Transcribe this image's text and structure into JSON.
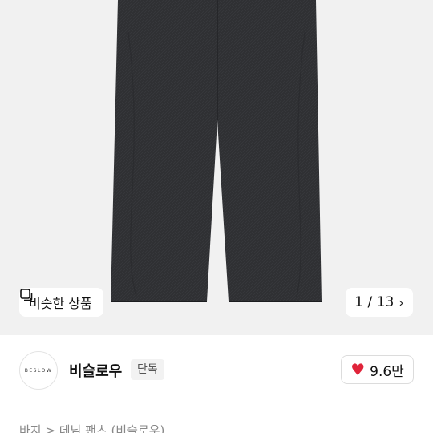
{
  "product_image": {
    "similar_label": "비슷한 상품",
    "similar_icon": "copy-square-icon",
    "counter": "1 / 13",
    "counter_icon": "chevron-right-icon",
    "background": "#f1f1f1",
    "denim_color": "#2f3033"
  },
  "brand": {
    "logo_text": "BESLOW",
    "name": "비슬로우",
    "tag": "단독"
  },
  "like": {
    "icon": "heart-icon",
    "count": "9.6만",
    "color": "#e0243a"
  },
  "breadcrumb": {
    "text": "바지 > 데님 팬츠 (비슬로우)"
  }
}
